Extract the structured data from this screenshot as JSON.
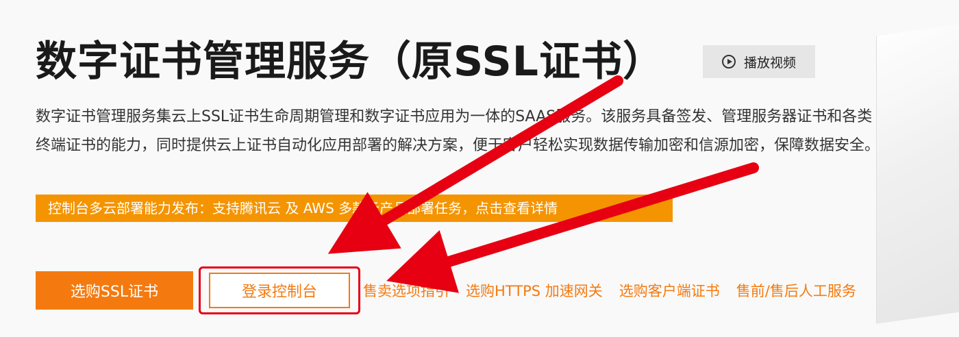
{
  "hero": {
    "title": "数字证书管理服务（原SSL证书）",
    "video_button_label": "播放视频",
    "description": "数字证书管理服务集云上SSL证书生命周期管理和数字证书应用为一体的SAAS服务。该服务具备签发、管理服务器证书和各类终端证书的能力，同时提供云上证书自动化应用部署的解决方案，便于客户轻松实现数据传输加密和信源加密，保障数据安全。",
    "announcement": "控制台多云部署能力发布：支持腾讯云 及 AWS 多款云产品部署任务，点击查看详情"
  },
  "actions": {
    "buy_ssl_label": "选购SSL证书",
    "console_label": "登录控制台",
    "links": [
      "售卖选项指引",
      "选购HTTPS 加速网关",
      "选购客户端证书",
      "售前/售后人工服务"
    ]
  },
  "colors": {
    "accent_orange": "#f47a10",
    "banner_orange": "#f49400",
    "annotation_red": "#e60012"
  },
  "icons": {
    "video": "play-circle-icon"
  }
}
